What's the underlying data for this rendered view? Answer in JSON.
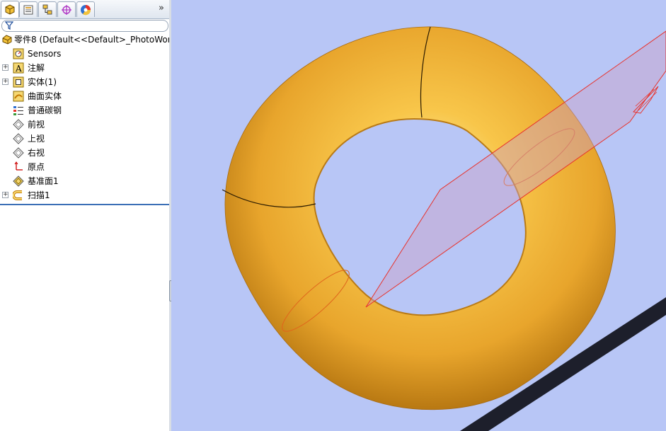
{
  "tabs": [
    {
      "name": "featuremanager-tab",
      "icon": "feature-manager-icon",
      "active": true
    },
    {
      "name": "propertymanager-tab",
      "icon": "property-manager-icon",
      "active": false
    },
    {
      "name": "configurationmanager-tab",
      "icon": "configuration-manager-icon",
      "active": false
    },
    {
      "name": "dimxpert-tab",
      "icon": "dimxpert-icon",
      "active": false
    },
    {
      "name": "display-manager-tab",
      "icon": "display-manager-icon",
      "active": false
    }
  ],
  "tab_overflow_label": "»",
  "tree": {
    "root_label": "零件8  (Default<<Default>_PhotoWorl",
    "items": [
      {
        "label": "Sensors",
        "icon": "sensors-icon",
        "expandable": false
      },
      {
        "label": "注解",
        "icon": "annotations-icon",
        "expandable": true
      },
      {
        "label": "实体(1)",
        "icon": "solid-bodies-icon",
        "expandable": true
      },
      {
        "label": "曲面实体",
        "icon": "surface-bodies-icon",
        "expandable": false
      },
      {
        "label": "普通碳钢",
        "icon": "material-icon",
        "expandable": false
      },
      {
        "label": "前视",
        "icon": "plane-icon",
        "expandable": false
      },
      {
        "label": "上视",
        "icon": "plane-icon",
        "expandable": false
      },
      {
        "label": "右视",
        "icon": "plane-icon",
        "expandable": false
      },
      {
        "label": "原点",
        "icon": "origin-icon",
        "expandable": false
      },
      {
        "label": "基准面1",
        "icon": "reference-plane-icon",
        "expandable": false
      },
      {
        "label": "扫描1",
        "icon": "sweep-feature-icon",
        "expandable": true
      }
    ]
  },
  "colors": {
    "viewport_bg": "#b8c6f6",
    "model_gold": "#f2b23a",
    "plane_edge": "#e8322b",
    "selection_highlight": "#3b6fb6"
  }
}
